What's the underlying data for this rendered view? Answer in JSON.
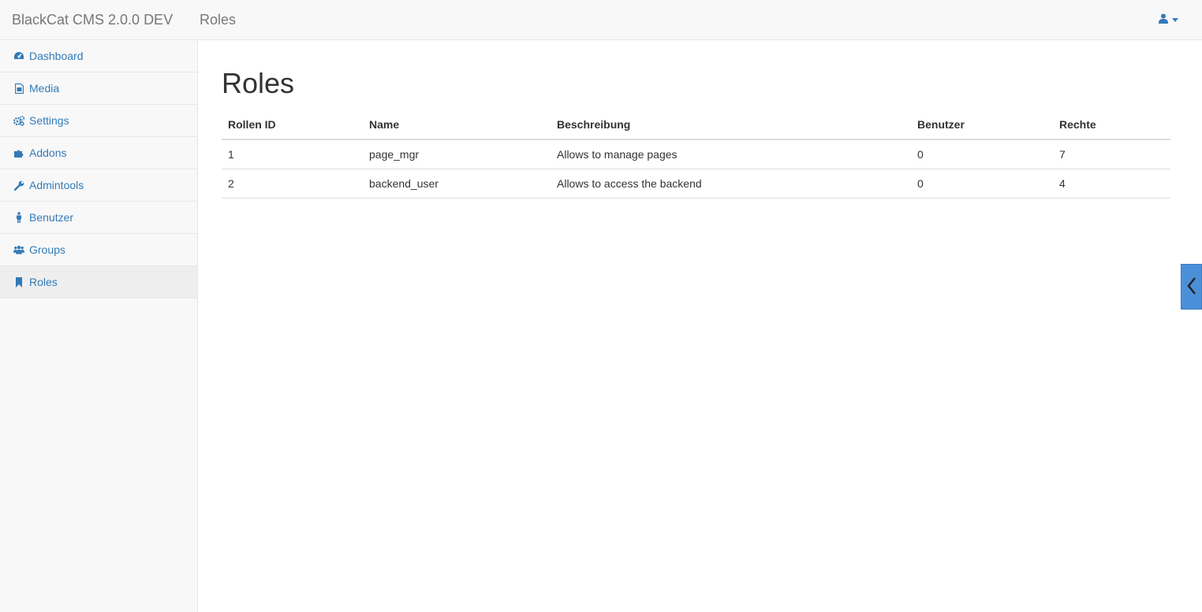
{
  "navbar": {
    "brand": "BlackCat CMS 2.0.0 DEV",
    "title": "Roles",
    "user_icon": "user-icon"
  },
  "sidebar": {
    "items": [
      {
        "label": "Dashboard",
        "icon": "dashboard-icon"
      },
      {
        "label": "Media",
        "icon": "file-image-icon"
      },
      {
        "label": "Settings",
        "icon": "gears-icon"
      },
      {
        "label": "Addons",
        "icon": "puzzle-icon"
      },
      {
        "label": "Admintools",
        "icon": "wrench-icon"
      },
      {
        "label": "Benutzer",
        "icon": "person-icon"
      },
      {
        "label": "Groups",
        "icon": "users-icon"
      },
      {
        "label": "Roles",
        "icon": "bookmark-icon",
        "active": true
      }
    ]
  },
  "main": {
    "title": "Roles",
    "table": {
      "headers": [
        "Rollen ID",
        "Name",
        "Beschreibung",
        "Benutzer",
        "Rechte"
      ],
      "rows": [
        [
          "1",
          "page_mgr",
          "Allows to manage pages",
          "0",
          "7"
        ],
        [
          "2",
          "backend_user",
          "Allows to access the backend",
          "0",
          "4"
        ]
      ]
    }
  },
  "colors": {
    "link": "#337ab7",
    "navbar_bg": "#f8f8f8",
    "toggle_bg": "#4a90d9"
  }
}
